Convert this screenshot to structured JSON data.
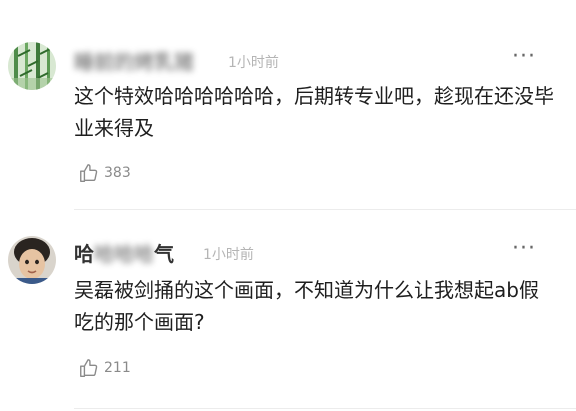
{
  "comments": [
    {
      "username_visible": "",
      "username_blurred": "睡前的烤乳猪",
      "time": "1小时前",
      "more": "···",
      "text": "这个特效哈哈哈哈哈哈，后期转专业吧，趁现在还没毕业来得及",
      "likes": "383",
      "avatar_icon": "bamboo-avatar"
    },
    {
      "username_visible": "哈",
      "username_blurred": "哈哈哈",
      "username_suffix": "气",
      "time": "1小时前",
      "more": "···",
      "text": "吴磊被剑捅的这个画面，不知道为什么让我想起ab假吃的那个画面?",
      "likes": "211",
      "avatar_icon": "child-avatar"
    }
  ],
  "icons": {
    "like": "thumbs-up-icon",
    "more": "more-dots-icon"
  },
  "colors": {
    "time": "#b5b5b5",
    "meta": "#8a8a8a",
    "divider": "#ececec"
  }
}
